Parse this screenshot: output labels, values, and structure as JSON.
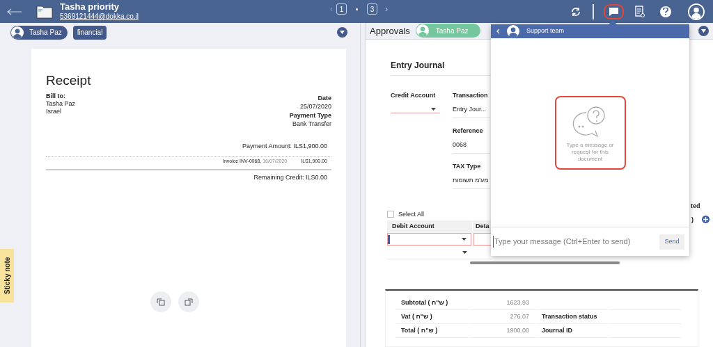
{
  "header": {
    "title": "Tasha priority",
    "email": "5369121444@dokka.co.il",
    "pager": {
      "prev": "‹",
      "next": "›",
      "pages": [
        {
          "label": "1",
          "selected": false
        },
        {
          "label": "3",
          "selected": false
        }
      ]
    },
    "chat_active": true
  },
  "left_bar": {
    "user": "Tasha Paz",
    "tag": "financial"
  },
  "receipt": {
    "title": "Receipt",
    "bill_to_label": "Bill to:",
    "bill_to": [
      "Tasha Paz",
      "Israel"
    ],
    "date_label": "Date",
    "date": "25/07/2020",
    "payment_type_label": "Payment Type",
    "payment_type": "Bank Transfer",
    "payment_amount": "Payment Amount: ILS1,900.00",
    "invoice": "Invoice INV-0068,",
    "invoice_date": "16/07/2020",
    "invoice_amount": "ILS1,900.00",
    "remaining": "Remaining Credit: ILS0.00"
  },
  "sticky_note": "Sticky note",
  "right_bar": {
    "label": "Approvals",
    "approver": "Tasha Paz"
  },
  "journal": {
    "title": "Entry Journal",
    "credit_account": {
      "label": "Credit Account",
      "invalid": true
    },
    "fields": [
      {
        "label": "Transaction",
        "value": "Entry Jour..."
      },
      {
        "label": "Reference",
        "value": "0068"
      },
      {
        "label": "TAX Type",
        "value": "מע'מ תשומות"
      }
    ],
    "select_all": {
      "label": "Select All",
      "checked": false
    },
    "columns": [
      "Debit Account",
      "Deta"
    ],
    "cut_header": "ted",
    "cut_cell": ")",
    "rows": [
      {
        "invalid": true
      },
      {
        "invalid": false
      }
    ],
    "totals": [
      {
        "label": "Subtotal ( ש\"ח )",
        "value": "1623.93"
      },
      {
        "label": "Vat ( ש\"ח )",
        "value": "276.07",
        "label_2": "Transaction status"
      },
      {
        "label": "Total ( ש\"ח )",
        "value": "1900.00",
        "label_2": "Journal ID"
      }
    ]
  },
  "chat": {
    "title": "Support team",
    "empty_text": "Type a message or request for this document",
    "placeholder": "Type your message (Ctrl+Enter to send)",
    "send": "Send"
  }
}
